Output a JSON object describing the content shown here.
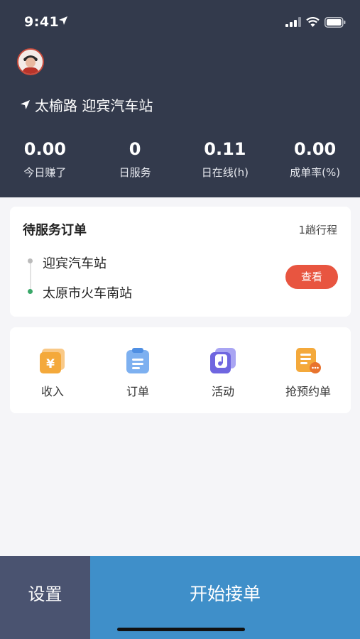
{
  "status": {
    "time": "9:41"
  },
  "location": {
    "name": "太榆路 迎宾汽车站"
  },
  "stats": [
    {
      "value": "0.00",
      "label": "今日赚了"
    },
    {
      "value": "0",
      "label": "日服务"
    },
    {
      "value": "0.11",
      "label": "日在线(h)"
    },
    {
      "value": "0.00",
      "label": "成单率(%)"
    }
  ],
  "pending_orders": {
    "title": "待服务订单",
    "trip_count": "1趟行程",
    "from": "迎宾汽车站",
    "to": "太原市火车南站",
    "view_label": "查看"
  },
  "menu": [
    {
      "label": "收入",
      "icon": "income-icon"
    },
    {
      "label": "订单",
      "icon": "orders-icon"
    },
    {
      "label": "活动",
      "icon": "activity-icon"
    },
    {
      "label": "抢预约单",
      "icon": "reservation-icon"
    }
  ],
  "bottom": {
    "settings_label": "设置",
    "start_label": "开始接单"
  },
  "colors": {
    "header_bg": "#333a4c",
    "accent_red": "#e85540",
    "start_blue": "#3f8fc9",
    "settings_bg": "#4a5370"
  }
}
